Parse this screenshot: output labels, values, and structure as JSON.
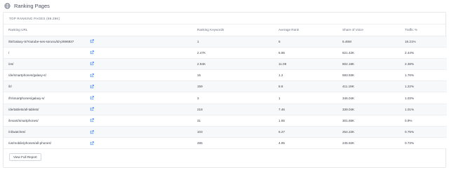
{
  "header": {
    "title": "Ranking Pages",
    "icon": "globe-icon"
  },
  "panel": {
    "title": "TOP RANKING PAGES  (89.29K)"
  },
  "table": {
    "columns": [
      "Ranking URL",
      "Ranking Keywords",
      "Average Rank",
      "Share of Voice",
      "Traffic %"
    ],
    "rows": [
      {
        "url": "/t5/Galaxy-S/Youtube-ses-sorunu/td-p/696937",
        "keywords": "1",
        "rank": "6",
        "sov": "5.46M",
        "traffic": "16.21%"
      },
      {
        "url": "/",
        "keywords": "2.47K",
        "rank": "6.95",
        "sov": "821.42K",
        "traffic": "2.44%"
      },
      {
        "url": "/es/",
        "keywords": "2.94K",
        "rank": "11.09",
        "sov": "802.18K",
        "traffic": "2.38%"
      },
      {
        "url": "/de/smartphones/galaxy-s/",
        "keywords": "15",
        "rank": "1.2",
        "sov": "593.93K",
        "traffic": "1.76%"
      },
      {
        "url": "/it/",
        "keywords": "159",
        "rank": "8.8",
        "sov": "411.19K",
        "traffic": "1.22%"
      },
      {
        "url": "/fr/smartphones/galaxy-s/",
        "keywords": "3",
        "rank": "1",
        "sov": "346.04K",
        "traffic": "1.03%"
      },
      {
        "url": "/de/tablets/all-tablets/",
        "keywords": "218",
        "rank": "7.46",
        "sov": "339.04K",
        "traffic": "1.01%"
      },
      {
        "url": "/levant/smartphones/",
        "keywords": "31",
        "rank": "1.55",
        "sov": "301.65K",
        "traffic": "0.9%"
      },
      {
        "url": "/nl/watches/",
        "keywords": "103",
        "rank": "6.27",
        "sov": "254.22K",
        "traffic": "0.75%"
      },
      {
        "url": "/us/mobile/phones/all-phones/",
        "keywords": "486",
        "rank": "4.95",
        "sov": "245.92K",
        "traffic": "0.73%"
      }
    ]
  },
  "footer": {
    "button_label": "View Full Report"
  },
  "colors": {
    "link_icon": "#3b82f6",
    "header_icon": "#6b7280"
  }
}
